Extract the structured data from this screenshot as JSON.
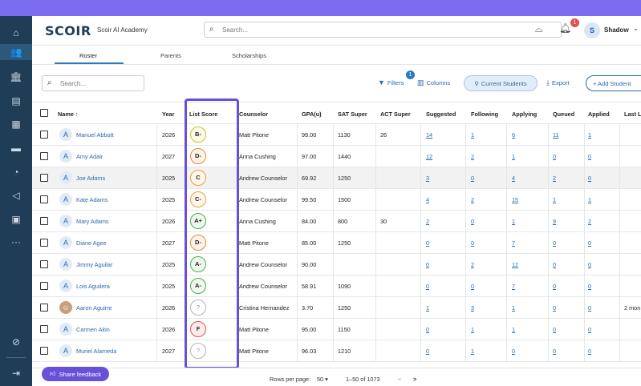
{
  "header": {
    "logo_text": "SCOIR",
    "school_name": "Scoir AI Academy",
    "search_placeholder": "Search...",
    "notification_count": "1",
    "user_initial": "S",
    "user_name": "Shadow"
  },
  "sidebar": {
    "icons": [
      "home-icon",
      "students-icon",
      "colleges-icon",
      "document-icon",
      "calendar-icon",
      "folder-icon",
      "analytics-icon",
      "announcement-icon",
      "reports-icon",
      "more-icon",
      "compass-icon",
      "collapse-icon"
    ]
  },
  "tabs": [
    {
      "label": "Roster",
      "active": true
    },
    {
      "label": "Parents",
      "active": false
    },
    {
      "label": "Scholarships",
      "active": false
    }
  ],
  "toolbar": {
    "search_placeholder": "Search...",
    "filters_label": "Filters",
    "filters_count": "1",
    "columns_label": "Columns",
    "current_students_label": "Current Students",
    "export_label": "Export",
    "add_student_label": "+ Add Student"
  },
  "table": {
    "columns": [
      "Name ↑",
      "Year",
      "List Score",
      "Counselor",
      "GPA(u)",
      "SAT Super",
      "ACT Super",
      "Suggested",
      "Following",
      "Applying",
      "Queued",
      "Applied",
      "Last L"
    ],
    "rows": [
      {
        "name": "Manuel Abbott",
        "avatar": "A",
        "year": "2026",
        "score": "B-",
        "counselor": "Matt Pitone",
        "gpa": "99.00",
        "sat": "1130",
        "act": "26",
        "suggested": "14",
        "following": "1",
        "applying": "6",
        "queued": "11",
        "applied": "1",
        "last": ""
      },
      {
        "name": "Amy Adair",
        "avatar": "A",
        "year": "2027",
        "score": "D-",
        "counselor": "Anna Cushing",
        "gpa": "97.00",
        "sat": "1440",
        "act": "",
        "suggested": "12",
        "following": "2",
        "applying": "1",
        "queued": "0",
        "applied": "0",
        "last": ""
      },
      {
        "name": "Joe Adams",
        "avatar": "A",
        "year": "2025",
        "score": "C",
        "counselor": "Andrew Counselor",
        "gpa": "69.92",
        "sat": "1250",
        "act": "",
        "suggested": "3",
        "following": "0",
        "applying": "4",
        "queued": "2",
        "applied": "0",
        "last": ""
      },
      {
        "name": "Kate Adams",
        "avatar": "A",
        "year": "2025",
        "score": "C-",
        "counselor": "Andrew Counselor",
        "gpa": "99.50",
        "sat": "1500",
        "act": "",
        "suggested": "4",
        "following": "2",
        "applying": "15",
        "queued": "1",
        "applied": "1",
        "last": ""
      },
      {
        "name": "Mary Adams",
        "avatar": "A",
        "year": "2026",
        "score": "A+",
        "counselor": "Anna Cushing",
        "gpa": "84.00",
        "sat": "800",
        "act": "30",
        "suggested": "2",
        "following": "0",
        "applying": "1",
        "queued": "9",
        "applied": "2",
        "last": ""
      },
      {
        "name": "Diane Agee",
        "avatar": "A",
        "year": "2027",
        "score": "D-",
        "counselor": "Matt Pitone",
        "gpa": "85.00",
        "sat": "1250",
        "act": "",
        "suggested": "0",
        "following": "0",
        "applying": "7",
        "queued": "0",
        "applied": "0",
        "last": ""
      },
      {
        "name": "Jimmy Aguilar",
        "avatar": "A",
        "year": "2025",
        "score": "A-",
        "counselor": "Andrew Counselor",
        "gpa": "90.00",
        "sat": "",
        "act": "",
        "suggested": "0",
        "following": "2",
        "applying": "12",
        "queued": "0",
        "applied": "0",
        "last": ""
      },
      {
        "name": "Lois Aguilera",
        "avatar": "A",
        "year": "2025",
        "score": "A-",
        "counselor": "Andrew Counselor",
        "gpa": "58.91",
        "sat": "1090",
        "act": "",
        "suggested": "0",
        "following": "0",
        "applying": "7",
        "queued": "0",
        "applied": "0",
        "last": ""
      },
      {
        "name": "Aaron Aguirre",
        "avatar": "",
        "year": "2026",
        "score": "?",
        "counselor": "Cristina Hernandez",
        "gpa": "3.70",
        "sat": "1250",
        "act": "",
        "suggested": "1",
        "following": "3",
        "applying": "1",
        "queued": "0",
        "applied": "0",
        "last": "2 mon"
      },
      {
        "name": "Carmen Akin",
        "avatar": "A",
        "year": "2026",
        "score": "F",
        "counselor": "Matt Pitone",
        "gpa": "95.00",
        "sat": "1150",
        "act": "",
        "suggested": "0",
        "following": "1",
        "applying": "1",
        "queued": "0",
        "applied": "0",
        "last": ""
      },
      {
        "name": "Muriel Alameda",
        "avatar": "A",
        "year": "2027",
        "score": "?",
        "counselor": "Matt Pitone",
        "gpa": "96.03",
        "sat": "1210",
        "act": "",
        "suggested": "0",
        "following": "1",
        "applying": "0",
        "queued": "0",
        "applied": "0",
        "last": ""
      }
    ]
  },
  "score_colors": {
    "A+": {
      "border": "#4caf50",
      "bg": "#eef8ee"
    },
    "A-": {
      "border": "#4caf50",
      "bg": "#eef8ee"
    },
    "B-": {
      "border": "#c9c22c",
      "bg": "#fbfbe8"
    },
    "C": {
      "border": "#e6a23c",
      "bg": "#fff7ea"
    },
    "C-": {
      "border": "#e6a23c",
      "bg": "#fff7ea"
    },
    "D-": {
      "border": "#e6873c",
      "bg": "#fff3e8"
    },
    "F": {
      "border": "#e05252",
      "bg": "#fdecec"
    },
    "?": {
      "border": "#b0b4b8",
      "bg": "#ffffff"
    }
  },
  "footer": {
    "feedback_label": "Share feedback",
    "rows_per_page_label": "Rows per page:",
    "rows_per_page_value": "50",
    "range": "1–50 of 1073",
    "prev": "<",
    "next": ">"
  }
}
